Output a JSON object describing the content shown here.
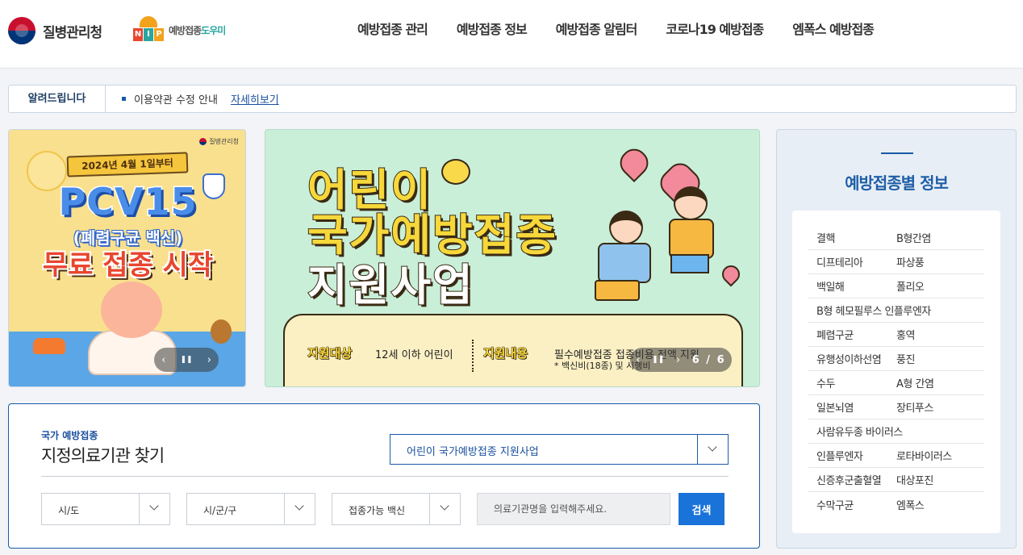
{
  "header": {
    "org_name": "질병관리청",
    "nip_letters": [
      "N",
      "I",
      "P"
    ],
    "nip_text_main": "예방접종",
    "nip_text_accent": "도우미",
    "nav": [
      "예방접종 관리",
      "예방접종 정보",
      "예방접종 알림터",
      "코로나19 예방접종",
      "엠폭스 예방접종"
    ]
  },
  "notice": {
    "title": "알려드립니다",
    "text": "이용약관 수정 안내",
    "more": "자세히보기"
  },
  "banner1": {
    "org": "질병관리청",
    "date": "2024년 4월 1일부터",
    "line1": "PCV15",
    "line2": "(폐렴구균 백신)",
    "line3": "무료 접종 시작",
    "prev_icon": "‹",
    "pause_icon": "❚❚",
    "next_icon": "›"
  },
  "banner2": {
    "line1": "어린이",
    "line2": "국가예방접종",
    "line3": "지원사업",
    "target_label": "지원대상",
    "target_value": "12세 이하 어린이",
    "content_label": "지원내용",
    "content_value": "필수예방접종 접종비용 전액 지원",
    "content_note": "* 백신비(18종) 및 시행비",
    "prev_icon": "‹",
    "pause_icon": "❚❚",
    "next_icon": "›",
    "counter": "6 / 6"
  },
  "finder": {
    "subtitle": "국가 예방접종",
    "title": "지정의료기관 찾기",
    "program": "어린이 국가예방접종 지원사업",
    "selects": [
      "시/도",
      "시/군/구",
      "접종가능 백신"
    ],
    "search_placeholder": "의료기관명을 입력해주세요.",
    "search_button": "검색"
  },
  "vaccine_info": {
    "title": "예방접종별 정보",
    "rows": [
      [
        "결핵",
        "B형간염"
      ],
      [
        "디프테리아",
        "파상풍"
      ],
      [
        "백일해",
        "폴리오"
      ],
      [
        "B형 헤모필루스 인플루엔자"
      ],
      [
        "폐렴구균",
        "홍역"
      ],
      [
        "유행성이하선염",
        "풍진"
      ],
      [
        "수두",
        "A형 간염"
      ],
      [
        "일본뇌염",
        "장티푸스"
      ],
      [
        "사람유두종 바이러스"
      ],
      [
        "인플루엔자",
        "로타바이러스"
      ],
      [
        "신증후군출혈열",
        "대상포진"
      ],
      [
        "수막구균",
        "엠폭스"
      ]
    ]
  },
  "colors": {
    "primary": "#1a5aa6",
    "search_button": "#1a73d9",
    "page_bg": "#f2f4f7",
    "banner1_bg": "#f9e08e",
    "banner2_bg": "#c9efd9"
  }
}
